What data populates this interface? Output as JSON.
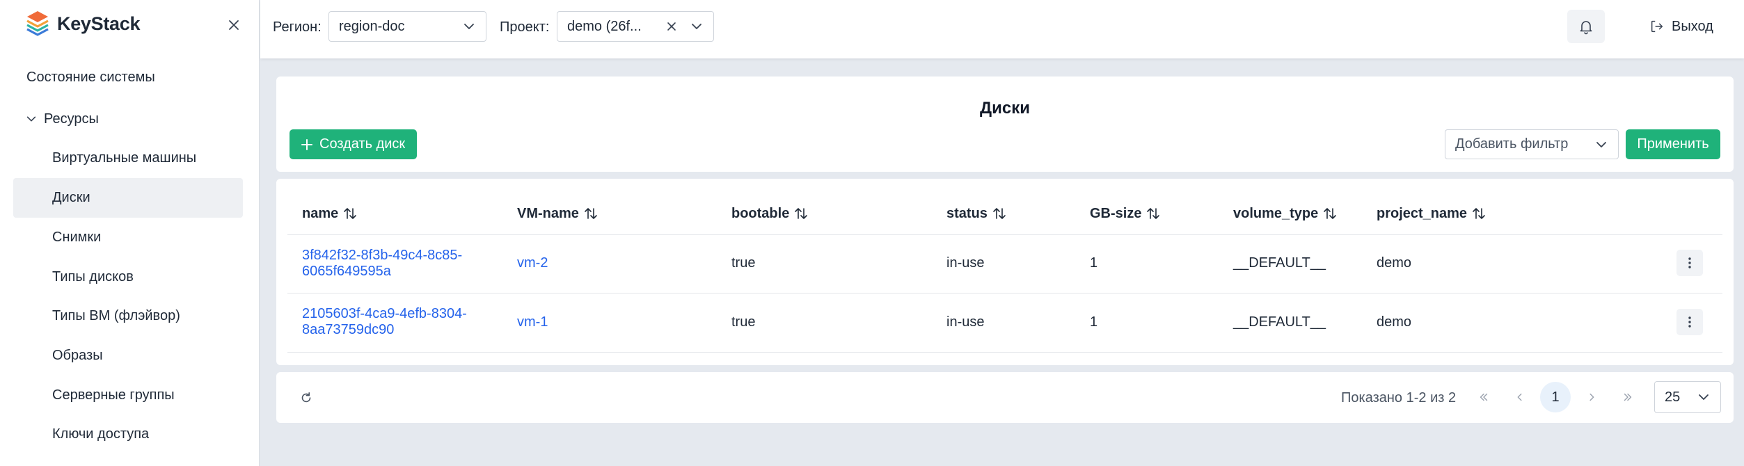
{
  "brand": {
    "name": "KeyStack"
  },
  "sidebar": {
    "system_status": "Состояние системы",
    "resources": "Ресурсы",
    "items": [
      {
        "label": "Виртуальные машины",
        "active": false
      },
      {
        "label": "Диски",
        "active": true
      },
      {
        "label": "Снимки",
        "active": false
      },
      {
        "label": "Типы дисков",
        "active": false
      },
      {
        "label": "Типы ВМ (флэйвор)",
        "active": false
      },
      {
        "label": "Образы",
        "active": false
      },
      {
        "label": "Серверные группы",
        "active": false
      },
      {
        "label": "Ключи доступа",
        "active": false
      }
    ]
  },
  "topbar": {
    "region_label": "Регион:",
    "region_value": "region-doc",
    "project_label": "Проект:",
    "project_value": "demo (26f...",
    "logout_label": "Выход"
  },
  "page": {
    "title": "Диски",
    "create_button": "Создать диск",
    "filter_placeholder": "Добавить фильтр",
    "apply_button": "Применить"
  },
  "table": {
    "columns": [
      "name",
      "VM-name",
      "bootable",
      "status",
      "GB-size",
      "volume_type",
      "project_name"
    ],
    "rows": [
      {
        "name_line1": "3f842f32-8f3b-49c4-8c85-",
        "name_line2": "6065f649595a",
        "vm": "vm-2",
        "bootable": "true",
        "status": "in-use",
        "size": "1",
        "volume_type": "__DEFAULT__",
        "project": "demo"
      },
      {
        "name_line1": "2105603f-4ca9-4efb-8304-",
        "name_line2": "8aa73759dc90",
        "vm": "vm-1",
        "bootable": "true",
        "status": "in-use",
        "size": "1",
        "volume_type": "__DEFAULT__",
        "project": "demo"
      }
    ]
  },
  "pagination": {
    "shown_text": "Показано 1-2 из 2",
    "current_page": "1",
    "per_page": "25"
  },
  "colors": {
    "accent": "#1fb27a",
    "link": "#2563eb",
    "background": "#e5e9ef"
  }
}
